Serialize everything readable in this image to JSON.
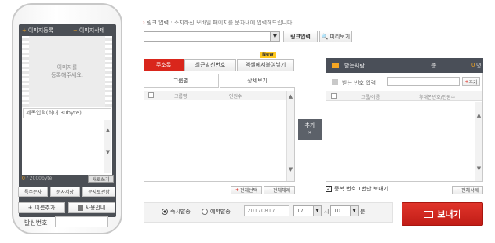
{
  "phone": {
    "tab_image_register": "이미지등록",
    "tab_image_delete": "이미지삭제",
    "image_placeholder_line1": "이미지를",
    "image_placeholder_line2": "등록해주세요.",
    "title_field": "제목입력(최대 30byte)",
    "byte_used": "0",
    "byte_max": "/ 2000byte",
    "rewrite_button": "새로쓰기",
    "special_chars_button": "특수문자",
    "save_message_button": "문자저장",
    "message_box_button": "문자보관함",
    "add_name_button": "이름추가",
    "guide_button": "사용안내",
    "sender_number_label": "발신번호"
  },
  "link": {
    "label": "링크 입력",
    "description": ": 소지하신 모바일 페이지를 문자내에 입력해드립니다.",
    "input_button": "링크입력",
    "preview_button": "미리보기"
  },
  "tabs": {
    "address_book": "주소록",
    "recent_sender": "최근발신번호",
    "excel_import": "엑셀에서붙여넣기",
    "new_badge": "New"
  },
  "address": {
    "subtab_group": "그룹별",
    "subtab_detail": "상세보기",
    "col_group": "그룹명",
    "col_count": "인원수",
    "select_all": "전체선택",
    "deselect_all": "전체해제"
  },
  "add_button": "추가",
  "recipients": {
    "title": "받는사람",
    "count_label": "총",
    "count": "0",
    "count_unit": "명",
    "input_label": "받는 번호 입력",
    "add_small": "추가",
    "col_group_name": "그룹/이름",
    "col_phone": "휴대폰번호/인원수",
    "dedupe_label": "중복 번호 1번만 보내기",
    "delete_all": "전체삭제"
  },
  "schedule": {
    "immediate": "즉시발송",
    "reserve": "예약발송",
    "date": "20170817",
    "hour": "17",
    "hour_unit": "시",
    "minute": "10",
    "minute_unit": "분"
  },
  "send_button": "보내기",
  "colors": {
    "accent_red": "#d9261c",
    "dark_panel": "#4a4f58",
    "send_red": "#cc1f1f"
  }
}
